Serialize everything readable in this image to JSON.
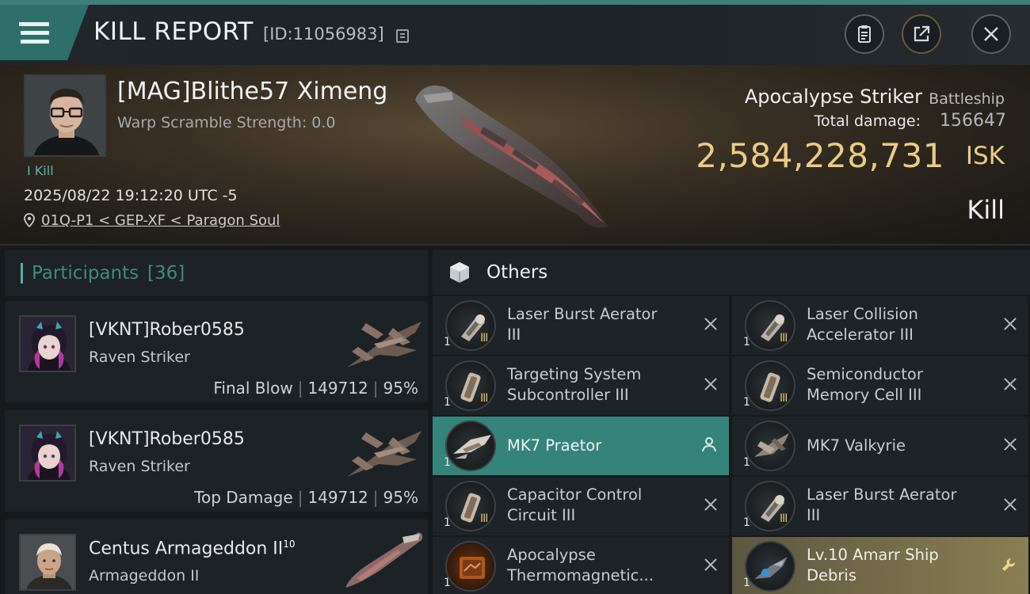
{
  "header": {
    "title": "KILL REPORT",
    "report_id": "[ID:11056983]"
  },
  "victim": {
    "name": "[MAG]Blithe57 Ximeng",
    "warp_scramble": "Warp Scramble Strength: 0.0",
    "kills": "I Kill",
    "datetime": "2025/08/22 19:12:20 UTC -5",
    "location": "01Q-P1 < GEP-XF < Paragon Soul"
  },
  "ship": {
    "name": "Apocalypse Striker",
    "class": "Battleship",
    "damage_label": "Total damage:",
    "damage_value": "156647",
    "isk_value": "2,584,228,731",
    "isk_unit": "ISK",
    "result": "Kill"
  },
  "participants": {
    "title": "Participants",
    "count": "[36]",
    "list": [
      {
        "name": "[VKNT]Rober0585",
        "ship": "Raven Striker",
        "label": "Final Blow",
        "damage": "149712",
        "percent": "95%"
      },
      {
        "name": "[VKNT]Rober0585",
        "ship": "Raven Striker",
        "label": "Top Damage",
        "damage": "149712",
        "percent": "95%"
      },
      {
        "name": "Centus Armageddon II",
        "level": "10",
        "ship": "Armageddon II"
      }
    ]
  },
  "others": {
    "title": "Others",
    "items": [
      {
        "name_l1": "Laser Burst Aerator",
        "name_l2": "III",
        "qty": "1",
        "tier": "III"
      },
      {
        "name_l1": "Laser Collision",
        "name_l2": "Accelerator III",
        "qty": "1",
        "tier": "III"
      },
      {
        "name_l1": "Targeting System",
        "name_l2": "Subcontroller III",
        "qty": "1",
        "tier": "III"
      },
      {
        "name_l1": "Semiconductor",
        "name_l2": "Memory Cell III",
        "qty": "1",
        "tier": "III"
      },
      {
        "name_l1": "MK7  Praetor",
        "name_l2": "",
        "qty": "1",
        "tier": ""
      },
      {
        "name_l1": "MK7  Valkyrie",
        "name_l2": "",
        "qty": "1",
        "tier": ""
      },
      {
        "name_l1": "Capacitor Control",
        "name_l2": "Circuit III",
        "qty": "1",
        "tier": "III"
      },
      {
        "name_l1": "Laser Burst Aerator",
        "name_l2": "III",
        "qty": "1",
        "tier": "III"
      },
      {
        "name_l1": "Apocalypse",
        "name_l2": "Thermomagnetic...",
        "qty": "1",
        "tier": ""
      },
      {
        "name_l1": "Lv.10 Amarr Ship",
        "name_l2": "Debris",
        "qty": "1",
        "tier": ""
      }
    ]
  },
  "colors": {
    "accent_teal": "#35847c",
    "isk_gold": "#eccb84",
    "kill_green": "#58b6a6"
  },
  "icons": [
    "menu-icon",
    "copy-icon",
    "clipboard-icon",
    "share-icon",
    "close-icon",
    "location-pin-icon",
    "box-icon",
    "remove-icon",
    "pilot-icon",
    "wrench-icon"
  ]
}
